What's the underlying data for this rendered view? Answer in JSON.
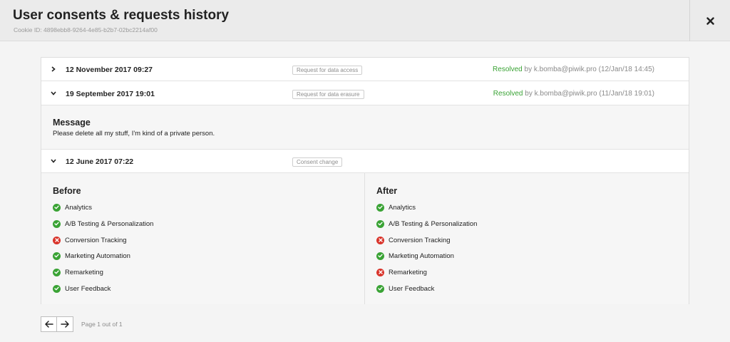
{
  "header": {
    "title": "User consents & requests history",
    "cookie_id": "Cookie ID: 4898ebb8-9264-4e85-b2b7-02bc2214af00",
    "close_icon": "close-icon"
  },
  "requests": [
    {
      "date": "12 November 2017 09:27",
      "type": "Request for data access",
      "status": "Resolved",
      "resolved_by": " by k.bomba@piwik.pro (12/Jan/18 14:45)",
      "expanded": false
    },
    {
      "date": "19 September 2017 19:01",
      "type": "Request for data erasure",
      "status": "Resolved",
      "resolved_by": " by k.bomba@piwik.pro (11/Jan/18 19:01)",
      "expanded": true
    },
    {
      "date": "12 June 2017 07:22",
      "type": "Consent change",
      "expanded": true
    }
  ],
  "message": {
    "title": "Message",
    "text": "Please delete all my stuff, I'm kind of a private person."
  },
  "consent_change": {
    "before_title": "Before",
    "after_title": "After",
    "before": [
      {
        "label": "Analytics",
        "granted": true
      },
      {
        "label": "A/B Testing & Personalization",
        "granted": true
      },
      {
        "label": "Conversion Tracking",
        "granted": false
      },
      {
        "label": "Marketing Automation",
        "granted": true
      },
      {
        "label": "Remarketing",
        "granted": true
      },
      {
        "label": "User Feedback",
        "granted": true
      }
    ],
    "after": [
      {
        "label": "Analytics",
        "granted": true
      },
      {
        "label": "A/B Testing & Personalization",
        "granted": true
      },
      {
        "label": "Conversion Tracking",
        "granted": false
      },
      {
        "label": "Marketing Automation",
        "granted": true
      },
      {
        "label": "Remarketing",
        "granted": false
      },
      {
        "label": "User Feedback",
        "granted": true
      }
    ]
  },
  "pagination": {
    "text": "Page 1 out of 1"
  },
  "colors": {
    "resolved": "#3aa335",
    "granted": "#3aa335",
    "denied": "#d9342b"
  }
}
